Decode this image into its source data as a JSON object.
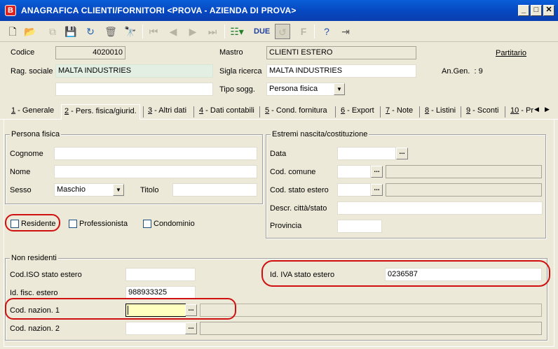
{
  "window": {
    "title": "ANAGRAFICA CLIENTI/FORNITORI <PROVA - AZIENDA DI PROVA>",
    "app_badge": "B",
    "btn_min": "_",
    "btn_max": "□",
    "btn_close": "✕"
  },
  "header": {
    "codice_label": "Codice",
    "codice_value": "4020010",
    "rag_sociale_label": "Rag. sociale",
    "rag_sociale_value": "MALTA INDUSTRIES",
    "rag_sociale2_value": "",
    "mastro_label": "Mastro",
    "mastro_value": "CLIENTI ESTERO",
    "sigla_label": "Sigla ricerca",
    "sigla_value": "MALTA INDUSTRIES",
    "tipo_label": "Tipo sogg.",
    "tipo_value": "Persona fisica",
    "partitario_label": "Partitario",
    "angen_label": "An.Gen.  : 9"
  },
  "tabs": [
    {
      "key": "1",
      "label": " - Generale"
    },
    {
      "key": "2",
      "label": " - Pers. fisica/giurid."
    },
    {
      "key": "3",
      "label": " - Altri dati"
    },
    {
      "key": "4",
      "label": " - Dati contabili"
    },
    {
      "key": "5",
      "label": " - Cond. fornitura"
    },
    {
      "key": "6",
      "label": " - Export"
    },
    {
      "key": "7",
      "label": " - Note"
    },
    {
      "key": "8",
      "label": " - Listini"
    },
    {
      "key": "9",
      "label": " - Sconti"
    },
    {
      "key": "10",
      "label": " - Pr"
    }
  ],
  "persona_fisica": {
    "title": "Persona fisica",
    "cognome_label": "Cognome",
    "cognome_value": "",
    "nome_label": "Nome",
    "nome_value": "",
    "sesso_label": "Sesso",
    "sesso_value": "Maschio",
    "titolo_label": "Titolo",
    "titolo_value": ""
  },
  "estremi": {
    "title": "Estremi nascita/costituzione",
    "data_label": "Data",
    "comune_label": "Cod. comune",
    "stato_label": "Cod. stato estero",
    "citta_label": "Descr. città/stato",
    "provincia_label": "Provincia"
  },
  "checkboxes": {
    "residente": "Residente",
    "professionista": "Professionista",
    "condominio": "Condominio"
  },
  "non_residenti": {
    "title": "Non residenti",
    "iso_label": "Cod.ISO stato estero",
    "iso_value": "",
    "fisc_label": "Id. fisc. estero",
    "fisc_value": "988933325",
    "naz1_label": "Cod. nazion. 1",
    "naz1_value": "",
    "naz2_label": "Cod. nazion. 2",
    "naz2_value": "",
    "iva_label": "Id. IVA stato estero",
    "iva_value": "0236587"
  },
  "colors": {
    "title_bar": "#0a5fd8",
    "highlight": "#d01010",
    "focus_field": "#ffffc0"
  }
}
